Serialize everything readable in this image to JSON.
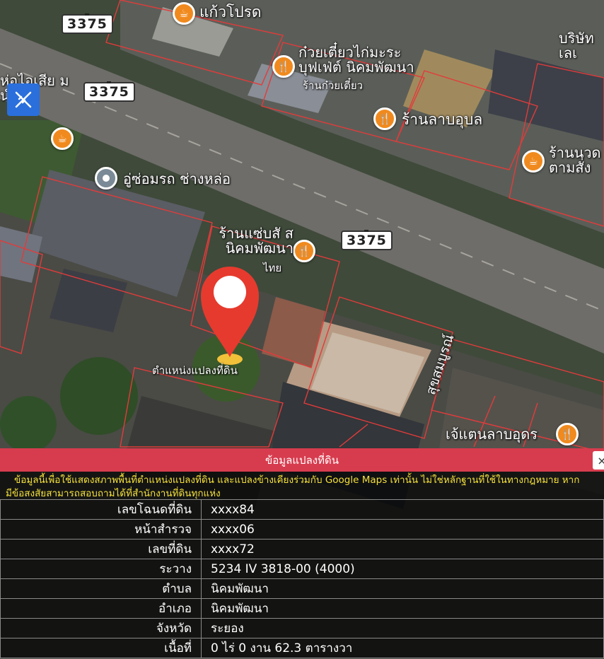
{
  "map": {
    "road_shields": [
      "3375",
      "3375",
      "3375"
    ],
    "pois": [
      {
        "label": "แก้วโปรด",
        "icon": "cafe-icon"
      },
      {
        "label": "ก๋วยเตี๋ยวไก่มะระ บุฟเฟ่ต์ นิคมพัฒนา",
        "sub": "ร้านก๋วยเตี๋ยว",
        "icon": "restaurant-icon"
      },
      {
        "label": "ร้านลาบอุบล",
        "icon": "restaurant-icon"
      },
      {
        "label": "ร้านนวด ตามสั่ง",
        "icon": "cafe-icon"
      },
      {
        "label": "อู่ซ่อมรถ ช่างหล่อ",
        "icon": "place-icon"
      },
      {
        "label": "ร้านแซ่บสั ส นิคมพัฒนา",
        "sub": "ไทย",
        "icon": "restaurant-icon"
      },
      {
        "label": "ห่อไอเสีย ม นำ",
        "icon": "cafe-icon"
      },
      {
        "label": "บริษัท เลเ",
        "icon": ""
      },
      {
        "label": "เจ้แตนลาบอุดร",
        "icon": "restaurant-icon"
      },
      {
        "label": "สุขสมบูรณ์",
        "icon": ""
      }
    ],
    "pin_caption": "ตำแหน่งแปลงที่ดิน",
    "accent_color": "#e63a2e"
  },
  "panel": {
    "title": "ข้อมูลแปลงที่ดิน",
    "close": "×",
    "notice_line1": "ข้อมูลนี้เพื่อใช้แสดงสภาพพื้นที่ตำแหน่งแปลงที่ดิน และแปลงข้างเคียงร่วมกับ Google Maps เท่านั้น ไม่ใช่หลักฐานที่ใช้ในทางกฎหมาย หาก",
    "notice_line2": "มีข้อสงสัยสามารถสอบถามได้ที่สำนักงานที่ดินทุกแห่ง",
    "rows": [
      {
        "key": "เลขโฉนดที่ดิน",
        "value": "xxxx84"
      },
      {
        "key": "หน้าสำรวจ",
        "value": "xxxx06"
      },
      {
        "key": "เลขที่ดิน",
        "value": "xxxx72"
      },
      {
        "key": "ระวาง",
        "value": "5234 IV 3818-00 (4000)"
      },
      {
        "key": "ตำบล",
        "value": "นิคมพัฒนา"
      },
      {
        "key": "อำเภอ",
        "value": "นิคมพัฒนา"
      },
      {
        "key": "จังหวัด",
        "value": "ระยอง"
      },
      {
        "key": "เนื้อที่",
        "value": "0 ไร่ 0 งาน 62.3 ตารางวา"
      }
    ]
  }
}
